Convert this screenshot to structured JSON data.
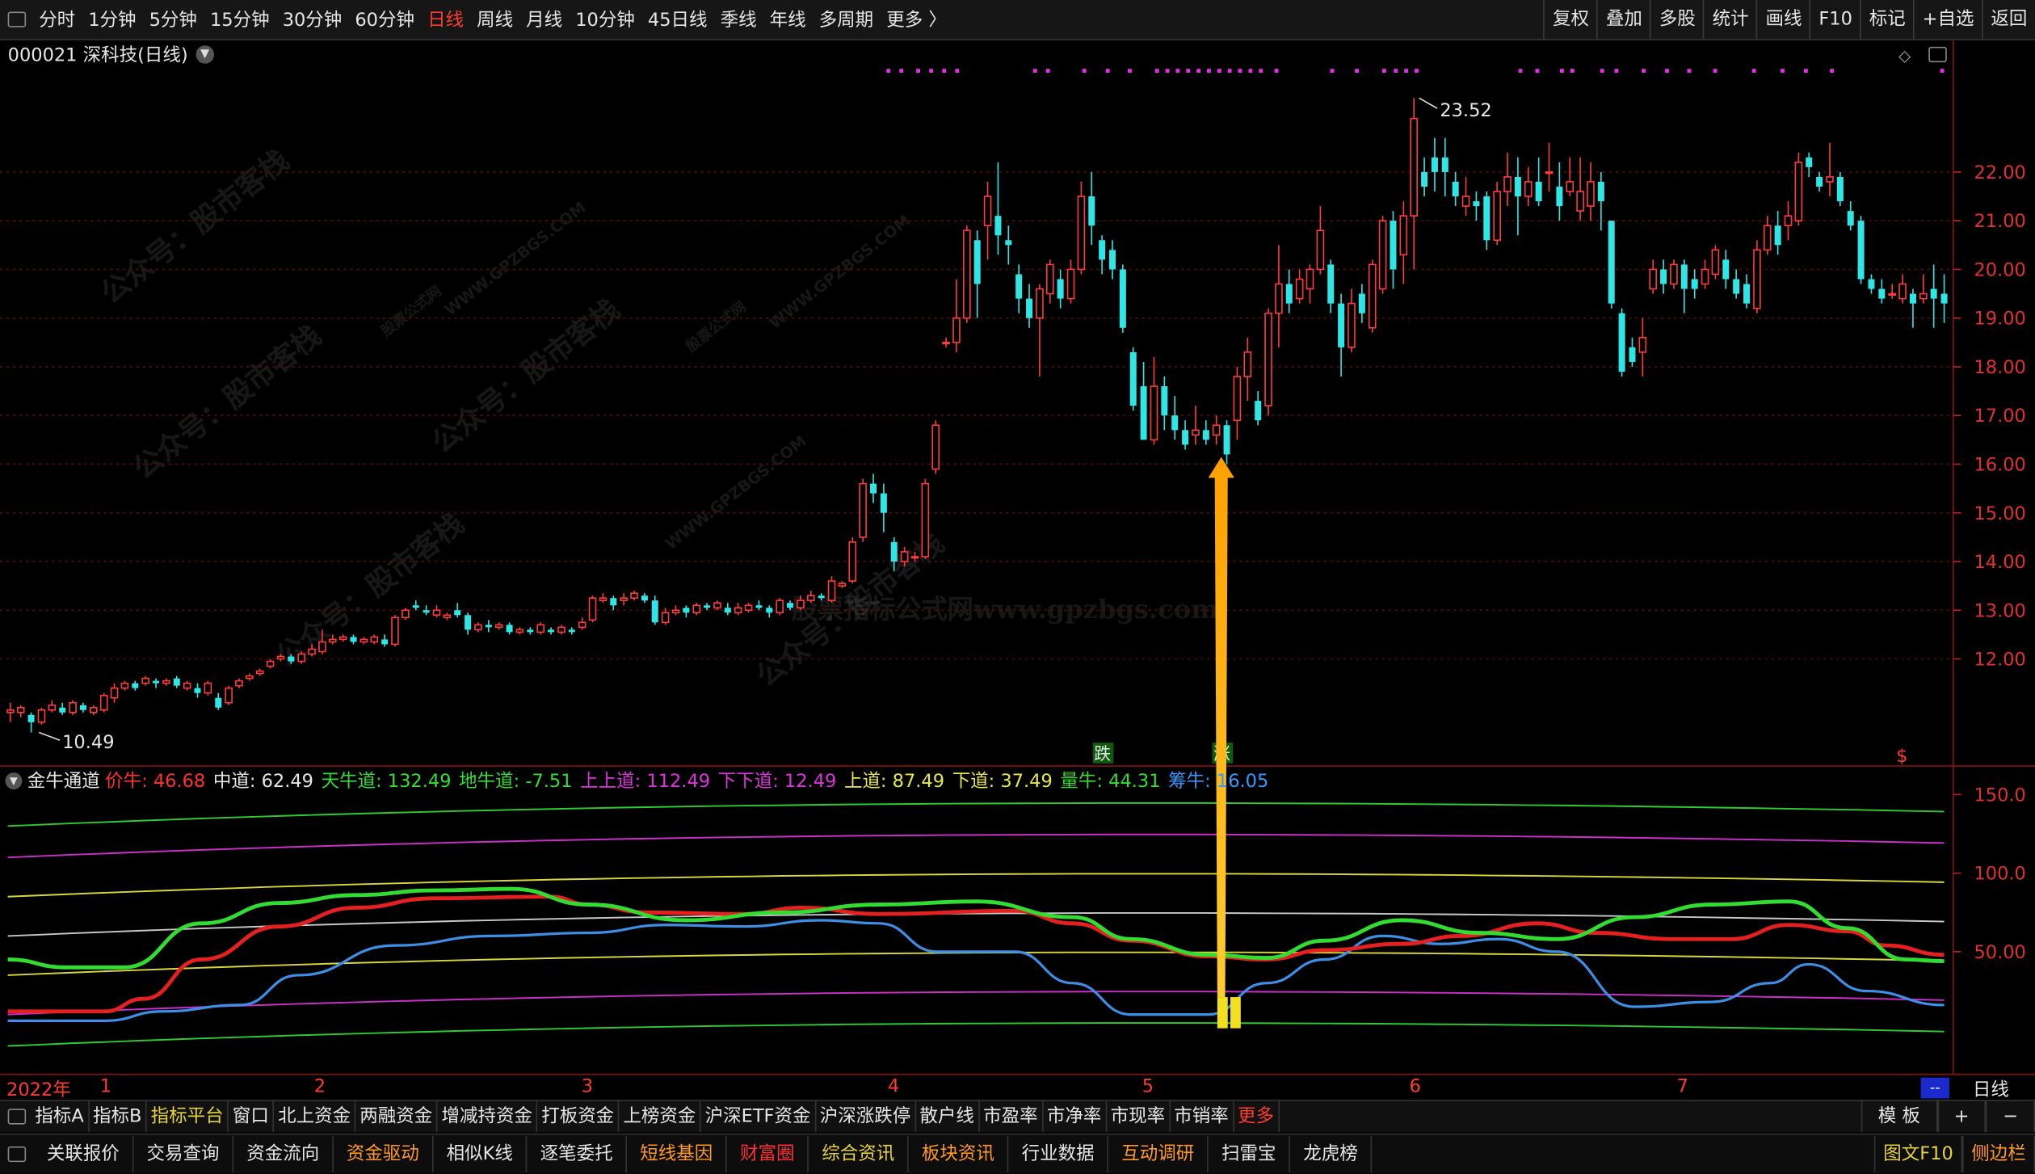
{
  "toolbar": {
    "periods": [
      "分时",
      "1分钟",
      "5分钟",
      "15分钟",
      "30分钟",
      "60分钟",
      "日线",
      "周线",
      "月线",
      "10分钟",
      "45日线",
      "季线",
      "年线",
      "多周期",
      "更多 〉"
    ],
    "active_period": "日线",
    "right_buttons": [
      "复权",
      "叠加",
      "多股",
      "统计",
      "画线",
      "F10",
      "标记",
      "+自选",
      "返回"
    ]
  },
  "chart_title": "000021 深科技(日线)",
  "price_axis_ticks": [
    "22.00",
    "21.00",
    "20.00",
    "19.00",
    "18.00",
    "17.00",
    "16.00",
    "15.00",
    "14.00",
    "13.00",
    "12.00"
  ],
  "price_annotations": {
    "high": "23.52",
    "low": "10.49"
  },
  "signal_labels": {
    "fall": "跌",
    "rise": "涨",
    "dollar": "$"
  },
  "watermarks": [
    "公众号：股市客栈",
    "WWW.GPZBGS.COM",
    "股票公式网",
    "股票指标公式网www.gpzbgs.com"
  ],
  "indicator": {
    "name": "金牛通道",
    "fields": [
      {
        "label": "价牛:",
        "value": "46.68",
        "color": "#ff3030"
      },
      {
        "label": "中道:",
        "value": "62.49",
        "color": "#e6e6e6"
      },
      {
        "label": "天牛道:",
        "value": "132.49",
        "color": "#33dd33"
      },
      {
        "label": "地牛道:",
        "value": "-7.51",
        "color": "#33dd33"
      },
      {
        "label": "上上道:",
        "value": "112.49",
        "color": "#dd33dd"
      },
      {
        "label": "下下道:",
        "value": "12.49",
        "color": "#dd33dd"
      },
      {
        "label": "上道:",
        "value": "87.49",
        "color": "#e6e64d"
      },
      {
        "label": "下道:",
        "value": "37.49",
        "color": "#e6e64d"
      },
      {
        "label": "量牛:",
        "value": "44.31",
        "color": "#33dd33"
      },
      {
        "label": "筹牛:",
        "value": "16.05",
        "color": "#3399ff"
      }
    ],
    "axis_ticks": [
      "150.0",
      "100.0",
      "50.00"
    ]
  },
  "time_axis": {
    "labels": [
      "2022年",
      "1",
      "2",
      "3",
      "4",
      "5",
      "6",
      "7"
    ],
    "right_label": "日线",
    "indicator_box": "--"
  },
  "bottom_tabs_1": {
    "items": [
      "指标A",
      "指标B",
      "指标平台",
      "窗口",
      "北上资金",
      "两融资金",
      "增减持资金",
      "打板资金",
      "上榜资金",
      "沪深ETF资金",
      "沪深涨跌停",
      "散户线",
      "市盈率",
      "市净率",
      "市现率",
      "市销率",
      "更多"
    ],
    "right": [
      "模 板",
      "+",
      "−"
    ]
  },
  "bottom_tabs_2": {
    "items": [
      {
        "label": "关联报价",
        "color": "#e6e6e6"
      },
      {
        "label": "交易查询",
        "color": "#e6e6e6"
      },
      {
        "label": "资金流向",
        "color": "#e6e6e6"
      },
      {
        "label": "资金驱动",
        "color": "#ff9922"
      },
      {
        "label": "相似K线",
        "color": "#e6e6e6"
      },
      {
        "label": "逐笔委托",
        "color": "#e6e6e6"
      },
      {
        "label": "短线基因",
        "color": "#ff9922"
      },
      {
        "label": "财富圈",
        "color": "#ff3030"
      },
      {
        "label": "综合资讯",
        "color": "#e6d23c"
      },
      {
        "label": "板块资讯",
        "color": "#ff9922"
      },
      {
        "label": "行业数据",
        "color": "#e6e6e6"
      },
      {
        "label": "互动调研",
        "color": "#ff9922"
      },
      {
        "label": "扫雷宝",
        "color": "#e6e6e6"
      },
      {
        "label": "龙虎榜",
        "color": "#e6e6e6"
      }
    ],
    "right": [
      {
        "label": "图文F10",
        "color": "#e6d23c"
      },
      {
        "label": "侧边栏",
        "color": "#ff9922"
      }
    ]
  },
  "candles": [
    [
      10.9,
      10.95,
      10.7,
      11.1
    ],
    [
      10.9,
      11.0,
      10.8,
      11.05
    ],
    [
      10.85,
      10.7,
      10.49,
      10.9
    ],
    [
      10.7,
      10.95,
      10.65,
      11.0
    ],
    [
      10.95,
      11.05,
      10.9,
      11.15
    ],
    [
      11.0,
      10.9,
      10.85,
      11.1
    ],
    [
      10.9,
      11.1,
      10.85,
      11.15
    ],
    [
      11.05,
      10.95,
      10.9,
      11.1
    ],
    [
      10.9,
      11.0,
      10.85,
      11.05
    ],
    [
      10.95,
      11.25,
      10.9,
      11.3
    ],
    [
      11.2,
      11.4,
      11.1,
      11.5
    ],
    [
      11.4,
      11.5,
      11.35,
      11.55
    ],
    [
      11.5,
      11.4,
      11.35,
      11.55
    ],
    [
      11.5,
      11.6,
      11.45,
      11.65
    ],
    [
      11.55,
      11.5,
      11.4,
      11.6
    ],
    [
      11.5,
      11.55,
      11.45,
      11.6
    ],
    [
      11.6,
      11.45,
      11.4,
      11.65
    ],
    [
      11.4,
      11.5,
      11.35,
      11.55
    ],
    [
      11.4,
      11.3,
      11.2,
      11.5
    ],
    [
      11.3,
      11.5,
      11.25,
      11.55
    ],
    [
      11.2,
      11.0,
      10.95,
      11.3
    ],
    [
      11.1,
      11.4,
      11.05,
      11.45
    ],
    [
      11.45,
      11.55,
      11.4,
      11.6
    ],
    [
      11.6,
      11.65,
      11.55,
      11.7
    ],
    [
      11.7,
      11.75,
      11.65,
      11.8
    ],
    [
      11.85,
      11.95,
      11.8,
      12.0
    ],
    [
      12.0,
      12.05,
      11.95,
      12.1
    ],
    [
      12.05,
      11.95,
      11.9,
      12.1
    ],
    [
      11.95,
      12.1,
      11.9,
      12.15
    ],
    [
      12.1,
      12.2,
      12.05,
      12.3
    ],
    [
      12.15,
      12.35,
      12.1,
      12.6
    ],
    [
      12.35,
      12.4,
      12.3,
      12.5
    ],
    [
      12.4,
      12.45,
      12.35,
      12.5
    ],
    [
      12.45,
      12.35,
      12.3,
      12.5
    ],
    [
      12.35,
      12.4,
      12.3,
      12.45
    ],
    [
      12.35,
      12.45,
      12.3,
      12.5
    ],
    [
      12.4,
      12.3,
      12.25,
      12.5
    ],
    [
      12.3,
      12.85,
      12.25,
      12.9
    ],
    [
      12.85,
      13.0,
      12.8,
      13.05
    ],
    [
      13.1,
      13.05,
      13.0,
      13.2
    ],
    [
      13.0,
      12.95,
      12.9,
      13.1
    ],
    [
      12.9,
      13.0,
      12.85,
      13.1
    ],
    [
      12.85,
      12.9,
      12.8,
      12.95
    ],
    [
      13.0,
      12.9,
      12.85,
      13.15
    ],
    [
      12.9,
      12.6,
      12.5,
      12.95
    ],
    [
      12.6,
      12.7,
      12.55,
      12.75
    ],
    [
      12.7,
      12.65,
      12.55,
      12.8
    ],
    [
      12.65,
      12.7,
      12.6,
      12.75
    ],
    [
      12.7,
      12.55,
      12.5,
      12.75
    ],
    [
      12.55,
      12.6,
      12.5,
      12.65
    ],
    [
      12.6,
      12.55,
      12.5,
      12.65
    ],
    [
      12.55,
      12.7,
      12.5,
      12.75
    ],
    [
      12.6,
      12.55,
      12.5,
      12.65
    ],
    [
      12.55,
      12.65,
      12.5,
      12.7
    ],
    [
      12.6,
      12.55,
      12.5,
      12.65
    ],
    [
      12.65,
      12.75,
      12.6,
      12.85
    ],
    [
      12.8,
      13.25,
      12.75,
      13.3
    ],
    [
      13.2,
      13.25,
      13.15,
      13.35
    ],
    [
      13.25,
      13.1,
      13.0,
      13.3
    ],
    [
      13.2,
      13.25,
      13.1,
      13.35
    ],
    [
      13.25,
      13.35,
      13.2,
      13.4
    ],
    [
      13.3,
      13.2,
      13.15,
      13.35
    ],
    [
      13.2,
      12.75,
      12.7,
      13.3
    ],
    [
      12.75,
      12.95,
      12.7,
      13.05
    ],
    [
      12.95,
      13.0,
      12.9,
      13.1
    ],
    [
      13.05,
      12.95,
      12.85,
      13.1
    ],
    [
      12.95,
      13.1,
      12.9,
      13.15
    ],
    [
      13.1,
      13.05,
      13.0,
      13.15
    ],
    [
      13.05,
      13.15,
      13.0,
      13.2
    ],
    [
      13.05,
      12.95,
      12.9,
      13.15
    ],
    [
      12.95,
      13.05,
      12.9,
      13.15
    ],
    [
      13.0,
      13.1,
      12.95,
      13.15
    ],
    [
      13.1,
      13.05,
      13.0,
      13.2
    ],
    [
      13.05,
      12.95,
      12.85,
      13.1
    ],
    [
      12.95,
      13.2,
      12.9,
      13.25
    ],
    [
      13.15,
      13.05,
      13.0,
      13.2
    ],
    [
      13.05,
      13.2,
      13.0,
      13.3
    ],
    [
      13.2,
      13.3,
      13.15,
      13.4
    ],
    [
      13.3,
      13.25,
      13.2,
      13.35
    ],
    [
      13.2,
      13.6,
      13.15,
      13.7
    ],
    [
      13.5,
      13.55,
      13.45,
      13.6
    ],
    [
      13.6,
      14.4,
      13.55,
      14.5
    ],
    [
      14.5,
      15.6,
      14.4,
      15.7
    ],
    [
      15.6,
      15.4,
      15.2,
      15.8
    ],
    [
      15.4,
      15.0,
      14.6,
      15.6
    ],
    [
      14.4,
      14.0,
      13.8,
      14.5
    ],
    [
      14.0,
      14.2,
      13.9,
      14.3
    ],
    [
      14.1,
      14.1,
      14.0,
      14.2
    ],
    [
      14.1,
      15.6,
      14.05,
      15.7
    ],
    [
      15.9,
      16.8,
      15.8,
      16.9
    ],
    [
      18.5,
      18.5,
      18.4,
      18.6
    ],
    [
      18.5,
      19.0,
      18.3,
      19.8
    ],
    [
      19.0,
      20.8,
      18.9,
      20.9
    ],
    [
      20.6,
      19.7,
      19.0,
      20.8
    ],
    [
      20.9,
      21.5,
      20.2,
      21.8
    ],
    [
      21.1,
      20.7,
      20.3,
      22.2
    ],
    [
      20.6,
      20.5,
      20.1,
      20.9
    ],
    [
      19.9,
      19.4,
      19.1,
      20.1
    ],
    [
      19.4,
      19.0,
      18.8,
      19.7
    ],
    [
      19.0,
      19.6,
      17.8,
      19.7
    ],
    [
      19.5,
      20.1,
      19.3,
      20.2
    ],
    [
      19.8,
      19.4,
      19.2,
      20.0
    ],
    [
      19.4,
      20.0,
      19.3,
      20.2
    ],
    [
      20.0,
      21.5,
      19.9,
      21.8
    ],
    [
      21.5,
      20.9,
      20.5,
      22.0
    ],
    [
      20.6,
      20.2,
      19.9,
      20.7
    ],
    [
      20.4,
      20.0,
      19.8,
      20.6
    ],
    [
      20.0,
      18.8,
      18.7,
      20.1
    ],
    [
      18.3,
      17.2,
      17.1,
      18.4
    ],
    [
      17.6,
      16.5,
      16.5,
      18.1
    ],
    [
      16.5,
      17.6,
      16.4,
      18.2
    ],
    [
      17.6,
      17.0,
      16.7,
      17.8
    ],
    [
      17.0,
      16.7,
      16.5,
      17.4
    ],
    [
      16.7,
      16.4,
      16.3,
      16.9
    ],
    [
      16.6,
      16.7,
      16.4,
      17.2
    ],
    [
      16.7,
      16.5,
      16.4,
      16.9
    ],
    [
      16.6,
      16.8,
      16.4,
      17.0
    ],
    [
      16.8,
      16.2,
      16.0,
      16.9
    ],
    [
      16.9,
      17.8,
      16.5,
      18.0
    ],
    [
      17.8,
      18.3,
      17.3,
      18.6
    ],
    [
      17.3,
      16.9,
      16.8,
      17.5
    ],
    [
      17.2,
      19.1,
      17.0,
      19.2
    ],
    [
      19.1,
      19.7,
      18.4,
      20.5
    ],
    [
      19.7,
      19.3,
      19.1,
      20.0
    ],
    [
      19.4,
      19.8,
      19.3,
      20.0
    ],
    [
      19.6,
      20.0,
      19.3,
      20.1
    ],
    [
      20.0,
      20.8,
      19.9,
      21.3
    ],
    [
      20.1,
      19.3,
      19.1,
      20.2
    ],
    [
      19.3,
      18.4,
      17.8,
      19.5
    ],
    [
      18.4,
      19.3,
      18.3,
      19.6
    ],
    [
      19.5,
      19.1,
      18.9,
      19.7
    ],
    [
      18.8,
      20.1,
      18.7,
      20.2
    ],
    [
      19.6,
      21.0,
      19.5,
      21.1
    ],
    [
      21.0,
      20.0,
      19.6,
      21.2
    ],
    [
      20.3,
      21.1,
      19.7,
      21.4
    ],
    [
      21.1,
      23.1,
      20.0,
      23.52
    ],
    [
      22.0,
      21.7,
      21.5,
      22.3
    ],
    [
      22.3,
      22.0,
      21.6,
      22.7
    ],
    [
      22.3,
      22.0,
      21.5,
      22.7
    ],
    [
      21.8,
      21.5,
      21.3,
      22.0
    ],
    [
      21.3,
      21.5,
      21.1,
      21.9
    ],
    [
      21.4,
      21.3,
      21.0,
      21.6
    ],
    [
      21.5,
      20.6,
      20.4,
      21.6
    ],
    [
      20.6,
      21.6,
      20.5,
      21.8
    ],
    [
      21.6,
      21.9,
      21.3,
      22.4
    ],
    [
      21.9,
      21.5,
      20.7,
      22.3
    ],
    [
      21.5,
      21.8,
      21.3,
      22.1
    ],
    [
      21.8,
      21.4,
      21.3,
      22.3
    ],
    [
      22.0,
      22.0,
      21.6,
      22.6
    ],
    [
      21.7,
      21.3,
      21.0,
      22.2
    ],
    [
      21.6,
      21.8,
      21.5,
      22.3
    ],
    [
      21.2,
      21.6,
      21.0,
      22.3
    ],
    [
      21.3,
      21.8,
      21.0,
      22.2
    ],
    [
      21.8,
      21.4,
      20.8,
      22.0
    ],
    [
      21.0,
      19.3,
      19.2,
      21.0
    ],
    [
      19.1,
      17.9,
      17.8,
      19.2
    ],
    [
      18.4,
      18.1,
      18.0,
      18.6
    ],
    [
      18.3,
      18.6,
      17.8,
      19.0
    ],
    [
      19.6,
      20.0,
      19.5,
      20.2
    ],
    [
      20.0,
      19.7,
      19.5,
      20.2
    ],
    [
      19.7,
      20.1,
      19.6,
      20.2
    ],
    [
      20.1,
      19.6,
      19.1,
      20.2
    ],
    [
      19.8,
      19.6,
      19.4,
      20.0
    ],
    [
      19.7,
      20.0,
      19.6,
      20.2
    ],
    [
      19.9,
      20.4,
      19.8,
      20.5
    ],
    [
      20.2,
      19.8,
      19.6,
      20.4
    ],
    [
      19.8,
      19.5,
      19.4,
      20.0
    ],
    [
      19.7,
      19.3,
      19.2,
      19.9
    ],
    [
      19.2,
      20.4,
      19.1,
      20.6
    ],
    [
      20.4,
      20.9,
      20.3,
      21.1
    ],
    [
      20.9,
      20.5,
      20.3,
      21.2
    ],
    [
      20.9,
      21.1,
      20.6,
      21.4
    ],
    [
      21.0,
      22.2,
      20.9,
      22.4
    ],
    [
      22.3,
      22.1,
      21.9,
      22.4
    ],
    [
      21.9,
      21.7,
      21.6,
      22.0
    ],
    [
      21.8,
      21.9,
      21.5,
      22.6
    ],
    [
      21.9,
      21.4,
      21.3,
      22.0
    ],
    [
      21.2,
      20.9,
      20.8,
      21.4
    ],
    [
      21.0,
      19.8,
      19.7,
      21.1
    ],
    [
      19.8,
      19.6,
      19.5,
      19.9
    ],
    [
      19.6,
      19.4,
      19.3,
      19.8
    ],
    [
      19.5,
      19.5,
      19.4,
      19.7
    ],
    [
      19.4,
      19.7,
      19.3,
      19.9
    ],
    [
      19.5,
      19.3,
      18.8,
      19.6
    ],
    [
      19.4,
      19.5,
      19.3,
      19.9
    ],
    [
      19.6,
      19.4,
      18.8,
      20.1
    ],
    [
      19.5,
      19.3,
      18.9,
      19.9
    ]
  ],
  "dots": [
    683,
    693,
    706,
    716,
    726,
    736,
    796,
    806,
    834,
    852,
    869,
    890,
    898,
    906,
    914,
    922,
    930,
    938,
    946,
    954,
    962,
    970,
    982,
    1025,
    1044,
    1065,
    1074,
    1082,
    1090,
    1170,
    1183,
    1202,
    1210,
    1233,
    1244,
    1265,
    1283,
    1300,
    1320,
    1350,
    1372,
    1390,
    1410,
    1495
  ],
  "ind_lines": {
    "tian": [
      130,
      146,
      141,
      150
    ],
    "shangshang": [
      110,
      126,
      121,
      130
    ],
    "shang": [
      85,
      101,
      96,
      105
    ],
    "zhong": [
      60,
      76,
      71,
      80
    ],
    "xia": [
      35,
      51,
      46,
      55
    ],
    "xiaxia": [
      10,
      26,
      21,
      30
    ],
    "di": [
      -10,
      6,
      1,
      10
    ],
    "jia": [
      [
        0,
        12
      ],
      [
        0.05,
        12
      ],
      [
        0.07,
        20
      ],
      [
        0.1,
        45
      ],
      [
        0.14,
        66
      ],
      [
        0.18,
        78
      ],
      [
        0.22,
        84
      ],
      [
        0.28,
        85
      ],
      [
        0.3,
        80
      ],
      [
        0.33,
        75
      ],
      [
        0.38,
        74
      ],
      [
        0.41,
        78
      ],
      [
        0.45,
        74
      ],
      [
        0.52,
        76
      ],
      [
        0.55,
        68
      ],
      [
        0.58,
        57
      ],
      [
        0.62,
        47
      ],
      [
        0.65,
        45
      ],
      [
        0.68,
        51
      ],
      [
        0.72,
        55
      ],
      [
        0.75,
        60
      ],
      [
        0.79,
        68
      ],
      [
        0.82,
        62
      ],
      [
        0.86,
        58
      ],
      [
        0.89,
        58
      ],
      [
        0.92,
        67
      ],
      [
        0.95,
        63
      ],
      [
        0.97,
        54
      ],
      [
        1.0,
        48
      ]
    ],
    "liang": [
      [
        0,
        45
      ],
      [
        0.03,
        40
      ],
      [
        0.06,
        40
      ],
      [
        0.1,
        68
      ],
      [
        0.14,
        81
      ],
      [
        0.18,
        86
      ],
      [
        0.22,
        89
      ],
      [
        0.26,
        90
      ],
      [
        0.3,
        80
      ],
      [
        0.35,
        70
      ],
      [
        0.4,
        75
      ],
      [
        0.45,
        80
      ],
      [
        0.5,
        82
      ],
      [
        0.55,
        72
      ],
      [
        0.58,
        58
      ],
      [
        0.62,
        48
      ],
      [
        0.65,
        46
      ],
      [
        0.68,
        57
      ],
      [
        0.72,
        70
      ],
      [
        0.76,
        62
      ],
      [
        0.8,
        58
      ],
      [
        0.84,
        72
      ],
      [
        0.88,
        80
      ],
      [
        0.92,
        82
      ],
      [
        0.95,
        65
      ],
      [
        0.98,
        45
      ],
      [
        1.0,
        44
      ]
    ],
    "chou": [
      [
        0,
        6
      ],
      [
        0.05,
        6
      ],
      [
        0.08,
        12
      ],
      [
        0.12,
        16
      ],
      [
        0.15,
        35
      ],
      [
        0.2,
        54
      ],
      [
        0.25,
        60
      ],
      [
        0.3,
        62
      ],
      [
        0.34,
        67
      ],
      [
        0.38,
        66
      ],
      [
        0.42,
        70
      ],
      [
        0.45,
        68
      ],
      [
        0.48,
        50
      ],
      [
        0.52,
        50
      ],
      [
        0.55,
        30
      ],
      [
        0.58,
        10
      ],
      [
        0.62,
        10
      ],
      [
        0.65,
        30
      ],
      [
        0.68,
        45
      ],
      [
        0.71,
        60
      ],
      [
        0.74,
        55
      ],
      [
        0.77,
        58
      ],
      [
        0.8,
        50
      ],
      [
        0.84,
        15
      ],
      [
        0.88,
        18
      ],
      [
        0.91,
        30
      ],
      [
        0.93,
        42
      ],
      [
        0.96,
        25
      ],
      [
        1.0,
        16
      ]
    ]
  }
}
